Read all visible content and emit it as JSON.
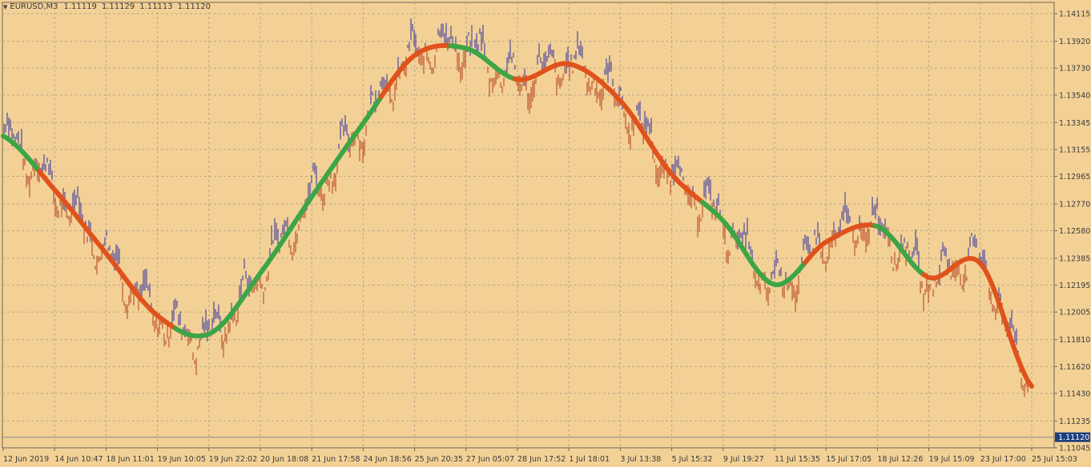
{
  "window": {
    "symbol": "EURUSD,M3",
    "open": "1.11119",
    "high": "1.11129",
    "low": "1.11113",
    "close": "1.11120"
  },
  "colors": {
    "background": "#f3d196",
    "grid": "#b9a78a",
    "axis_text": "#3b3b3b",
    "bars": "#2e2fa3",
    "bars_down": "#b33a1a",
    "ma_up": "#3ca546",
    "ma_down": "#e0521c",
    "price_label_bg": "#1c3f80",
    "price_label_text": "#ffffff"
  },
  "chart_data": {
    "type": "line",
    "title": "EURUSD,M3",
    "ylim": [
      1.11045,
      1.14195
    ],
    "y_ticks": [
      "1.14115",
      "1.13920",
      "1.13730",
      "1.13540",
      "1.13345",
      "1.13155",
      "1.12965",
      "1.12770",
      "1.12580",
      "1.12385",
      "1.12195",
      "1.12005",
      "1.11810",
      "1.11620",
      "1.11430",
      "1.11235",
      "1.11045"
    ],
    "x_ticks": [
      "12 Jun 2019",
      "14 Jun 10:47",
      "18 Jun 11:01",
      "19 Jun 10:05",
      "19 Jun 22:02",
      "20 Jun 18:08",
      "21 Jun 17:58",
      "24 Jun 18:56",
      "25 Jun 20:35",
      "27 Jun 05:07",
      "28 Jun 17:52",
      "1 Jul 18:01",
      "3 Jul 13:38",
      "5 Jul 15:32",
      "9 Jul 19:27",
      "11 Jul 15:35",
      "15 Jul 17:05",
      "18 Jul 12:26",
      "19 Jul 15:09",
      "23 Jul 17:00",
      "25 Jul 15:03"
    ],
    "current_price": "1.11120",
    "series": [
      {
        "kind": "moving-average",
        "x": [
          0,
          1,
          2,
          3,
          4,
          5,
          6,
          7,
          8,
          9,
          10,
          11,
          12,
          13,
          14,
          15,
          16,
          17,
          18,
          19,
          20
        ],
        "values": [
          1.1325,
          1.1287,
          1.1242,
          1.1198,
          1.1185,
          1.1228,
          1.1282,
          1.1334,
          1.1382,
          1.1387,
          1.1365,
          1.1376,
          1.135,
          1.1298,
          1.1265,
          1.122,
          1.125,
          1.1261,
          1.1225,
          1.1235,
          1.1148
        ],
        "segments": [
          {
            "from": 0,
            "to": 0.7,
            "trend": "up"
          },
          {
            "from": 0.7,
            "to": 3.35,
            "trend": "down"
          },
          {
            "from": 3.35,
            "to": 7.35,
            "trend": "up"
          },
          {
            "from": 7.35,
            "to": 8.7,
            "trend": "down"
          },
          {
            "from": 8.7,
            "to": 9.95,
            "trend": "up"
          },
          {
            "from": 9.95,
            "to": 13.6,
            "trend": "down"
          },
          {
            "from": 13.6,
            "to": 15.6,
            "trend": "up"
          },
          {
            "from": 15.6,
            "to": 16.95,
            "trend": "down"
          },
          {
            "from": 16.95,
            "to": 17.9,
            "trend": "up"
          },
          {
            "from": 17.9,
            "to": 20,
            "trend": "down"
          }
        ]
      }
    ]
  }
}
